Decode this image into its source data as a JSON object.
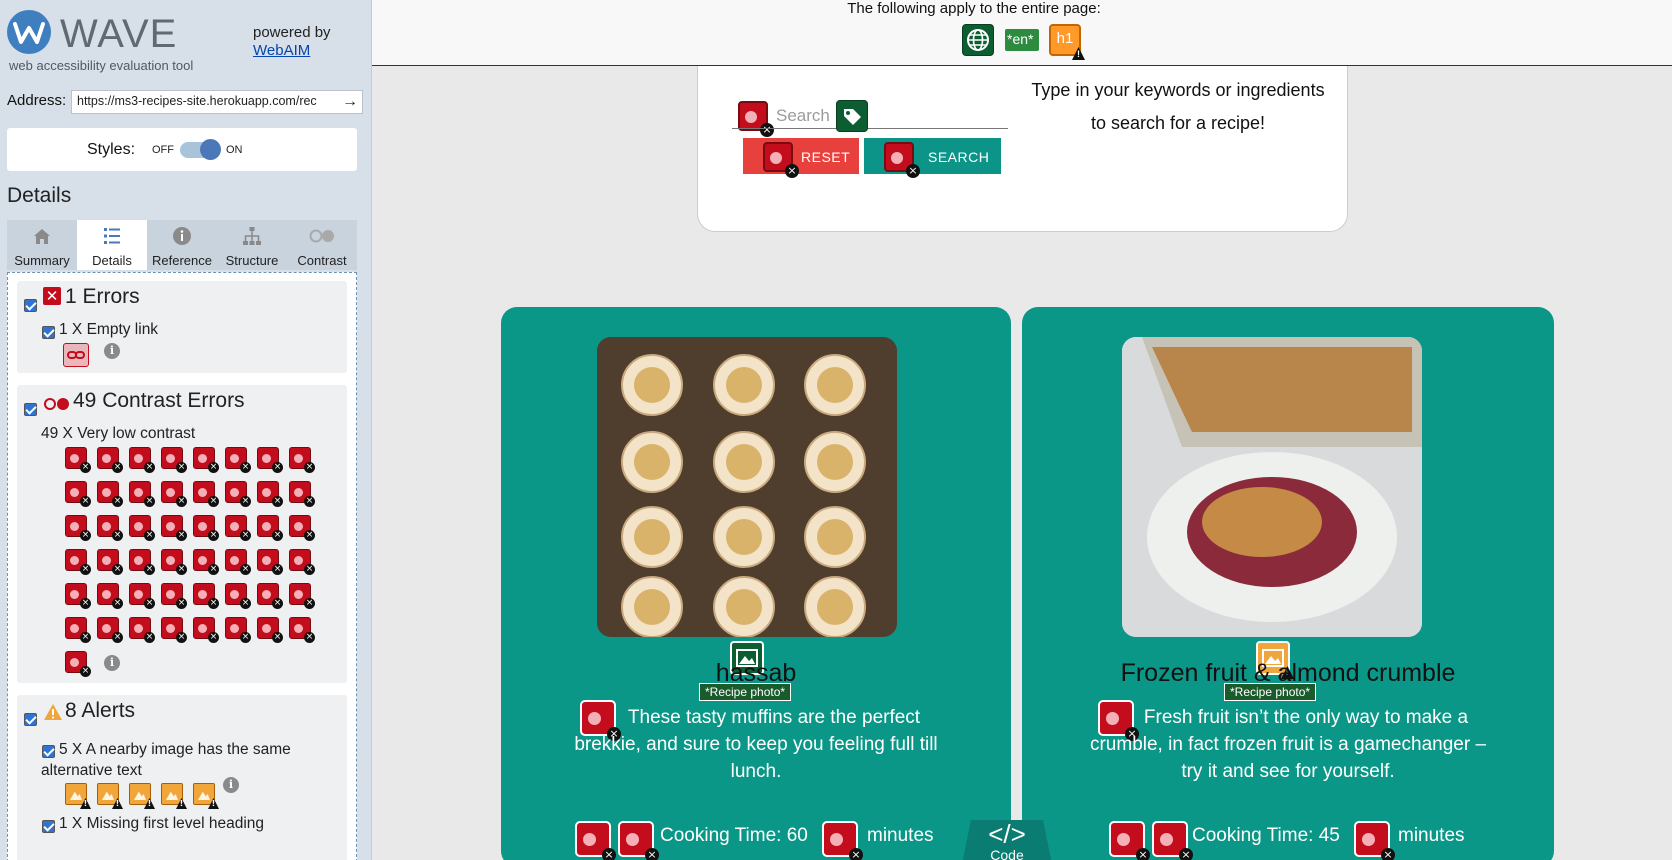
{
  "brand": {
    "name": "WAVE",
    "tagline": "web accessibility evaluation tool",
    "powered_by": "powered by",
    "webaim_link": "WebAIM"
  },
  "address": {
    "label": "Address:",
    "value": "https://ms3-recipes-site.herokuapp.com/rec"
  },
  "styles": {
    "label": "Styles:",
    "off": "OFF",
    "on": "ON",
    "enabled": true
  },
  "details_title": "Details",
  "tabs": [
    {
      "label": "Summary",
      "icon": "home-icon"
    },
    {
      "label": "Details",
      "icon": "list-icon",
      "active": true
    },
    {
      "label": "Reference",
      "icon": "info-icon"
    },
    {
      "label": "Structure",
      "icon": "hierarchy-icon"
    },
    {
      "label": "Contrast",
      "icon": "contrast-icon"
    }
  ],
  "errors": {
    "title": "1 Errors",
    "item": "1 X Empty link"
  },
  "contrast": {
    "title": "49 Contrast Errors",
    "item": "49 X Very low contrast",
    "count": 49
  },
  "alerts": {
    "title": "8 Alerts",
    "item1": "5 X A nearby image has the same alternative text",
    "item1_count": 5,
    "item2": "1 X Missing first level heading"
  },
  "topbar": {
    "text": "The following apply to the entire page:",
    "lang_code": "*en*",
    "heading_badge": "h1"
  },
  "search": {
    "placeholder": "Search",
    "reset": "RESET",
    "submit": "SEARCH",
    "hint": "Type in your keywords or ingredients to search for a recipe!"
  },
  "cards": [
    {
      "title": "hassab",
      "label": "*Recipe photo*",
      "desc": "These tasty muffins are the perfect brekkie, and sure to keep you feeling full till lunch.",
      "cook_prefix": "Cooking Time: 60",
      "cook_suffix": "minutes"
    },
    {
      "title": "Frozen fruit & almond crumble",
      "label": "*Recipe photo*",
      "desc": "Fresh fruit isn’t the only way to make a crumble, in fact frozen fruit is a gamechanger – try it and see for yourself.",
      "cook_prefix": "Cooking Time: 45",
      "cook_suffix": "minutes"
    }
  ],
  "code_tab": {
    "symbol": "</>",
    "label": "Code"
  },
  "colors": {
    "accent": "#0b9787",
    "error": "#c40d1c",
    "alert": "#f0a63a",
    "ok": "#0d5d32"
  }
}
